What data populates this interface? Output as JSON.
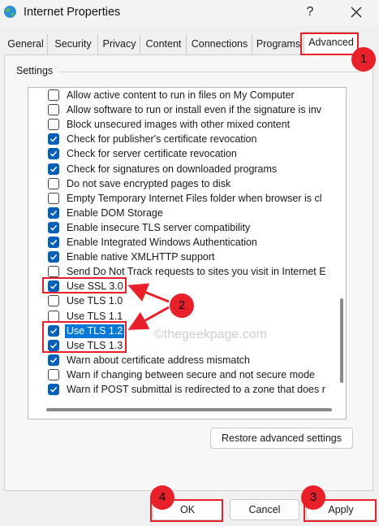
{
  "window": {
    "title": "Internet Properties",
    "help_label": "?"
  },
  "tabs": [
    {
      "label": "General"
    },
    {
      "label": "Security"
    },
    {
      "label": "Privacy"
    },
    {
      "label": "Content"
    },
    {
      "label": "Connections"
    },
    {
      "label": "Programs"
    },
    {
      "label": "Advanced",
      "active": true
    }
  ],
  "settings": {
    "group_label": "Settings",
    "items": [
      {
        "label": "Allow active content to run in files on My Computer",
        "checked": false
      },
      {
        "label": "Allow software to run or install even if the signature is inv",
        "checked": false
      },
      {
        "label": "Block unsecured images with other mixed content",
        "checked": false
      },
      {
        "label": "Check for publisher's certificate revocation",
        "checked": true
      },
      {
        "label": "Check for server certificate revocation",
        "checked": true
      },
      {
        "label": "Check for signatures on downloaded programs",
        "checked": true
      },
      {
        "label": "Do not save encrypted pages to disk",
        "checked": false
      },
      {
        "label": "Empty Temporary Internet Files folder when browser is cl",
        "checked": false
      },
      {
        "label": "Enable DOM Storage",
        "checked": true
      },
      {
        "label": "Enable insecure TLS server compatibility",
        "checked": true
      },
      {
        "label": "Enable Integrated Windows Authentication",
        "checked": true
      },
      {
        "label": "Enable native XMLHTTP support",
        "checked": true
      },
      {
        "label": "Send Do Not Track requests to sites you visit in Internet E",
        "checked": false
      },
      {
        "label": "Use SSL 3.0",
        "checked": true
      },
      {
        "label": "Use TLS 1.0",
        "checked": false
      },
      {
        "label": "Use TLS 1.1",
        "checked": false
      },
      {
        "label": "Use TLS 1.2",
        "checked": true,
        "selected": true
      },
      {
        "label": "Use TLS 1.3",
        "checked": true
      },
      {
        "label": "Warn about certificate address mismatch",
        "checked": true
      },
      {
        "label": "Warn if changing between secure and not secure mode",
        "checked": false
      },
      {
        "label": "Warn if POST submittal is redirected to a zone that does r",
        "checked": true
      }
    ],
    "restore_label": "Restore advanced settings"
  },
  "buttons": {
    "ok_label": "OK",
    "cancel_label": "Cancel",
    "apply_label": "Apply"
  },
  "annotations": {
    "badge_1": "1",
    "badge_2": "2",
    "badge_3": "3",
    "badge_4": "4",
    "color": "#e8202a"
  },
  "watermark": "©thegeekpage.com",
  "colors": {
    "checkbox_checked": "#005fb8",
    "selection": "#0078d7"
  }
}
